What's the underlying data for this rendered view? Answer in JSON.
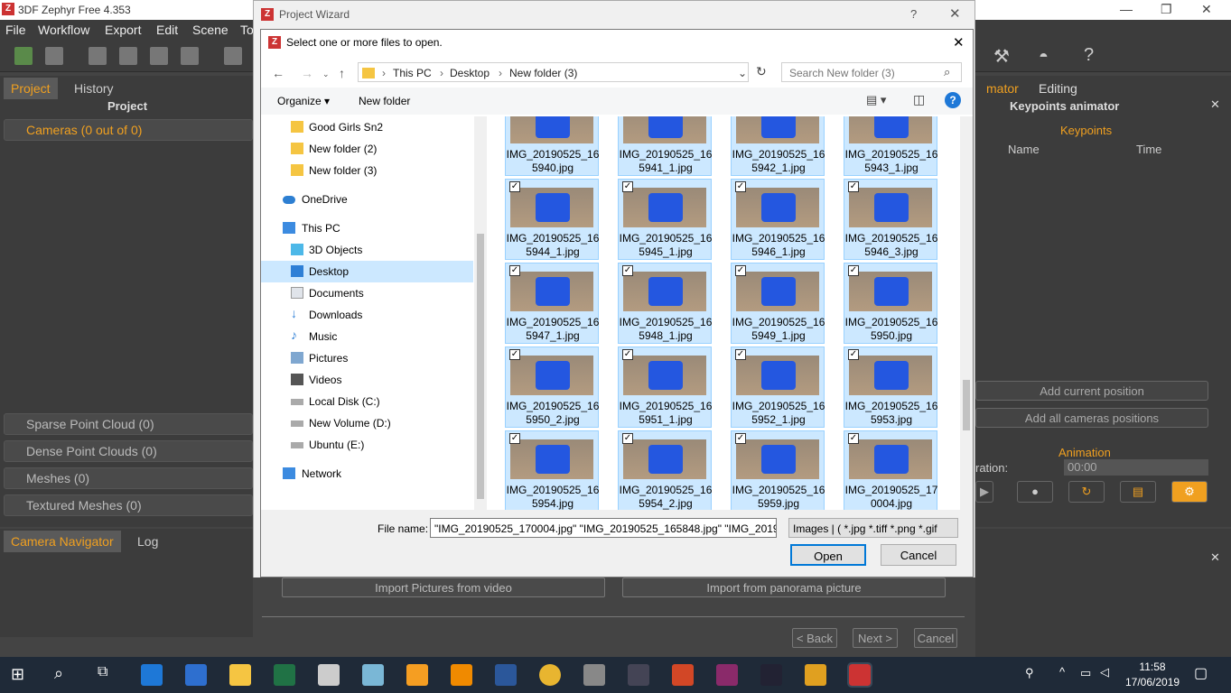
{
  "app": {
    "title": "3DF Zephyr Free 4.353",
    "logo": "Z",
    "menu": [
      "File",
      "Workflow",
      "Export",
      "Edit",
      "Scene",
      "To"
    ],
    "left_tabs": [
      "Project",
      "History"
    ],
    "project_header": "Project",
    "cameras": "Cameras (0 out of 0)",
    "sections": [
      "Sparse Point Cloud (0)",
      "Dense Point Clouds (0)",
      "Meshes (0)",
      "Textured Meshes (0)"
    ],
    "bottom_tabs": [
      "Camera Navigator",
      "Log"
    ],
    "right_tabs": [
      "mator",
      "Editing"
    ],
    "right_header": "Keypoints animator",
    "keypoints": {
      "title": "Keypoints",
      "col_name": "Name",
      "col_time": "Time"
    },
    "add_current": "Add current position",
    "add_all": "Add all cameras positions",
    "animation": {
      "title": "Animation",
      "duration_label": "ration:",
      "duration_value": "00:00"
    }
  },
  "wizard": {
    "title": "Project Wizard",
    "help": "?",
    "import_video": "Import Pictures from video",
    "import_panorama": "Import from panorama picture",
    "back": "< Back",
    "next": "Next >",
    "cancel": "Cancel"
  },
  "dialog": {
    "title": "Select one or more files to open.",
    "breadcrumb": [
      "This PC",
      "Desktop",
      "New folder (3)"
    ],
    "search_placeholder": "Search New folder (3)",
    "organize": "Organize ▾",
    "new_folder": "New folder",
    "nav": [
      {
        "label": "Good Girls Sn2",
        "icon": "folder-icon"
      },
      {
        "label": "New folder (2)",
        "icon": "folder-icon"
      },
      {
        "label": "New folder (3)",
        "icon": "folder-icon"
      },
      {
        "label": "OneDrive",
        "icon": "cloud-icon"
      },
      {
        "label": "This PC",
        "icon": "computer-icon"
      },
      {
        "label": "3D Objects",
        "icon": "cube-icon"
      },
      {
        "label": "Desktop",
        "icon": "desktop-icon"
      },
      {
        "label": "Documents",
        "icon": "document-icon"
      },
      {
        "label": "Downloads",
        "icon": "download-icon"
      },
      {
        "label": "Music",
        "icon": "music-icon"
      },
      {
        "label": "Pictures",
        "icon": "picture-icon"
      },
      {
        "label": "Videos",
        "icon": "video-icon"
      },
      {
        "label": "Local Disk (C:)",
        "icon": "disk-icon"
      },
      {
        "label": "New Volume (D:)",
        "icon": "disk-icon"
      },
      {
        "label": "Ubuntu (E:)",
        "icon": "disk-icon"
      },
      {
        "label": "Network",
        "icon": "network-icon"
      }
    ],
    "files": [
      [
        "IMG_20190525_16",
        "5940.jpg"
      ],
      [
        "IMG_20190525_16",
        "5941_1.jpg"
      ],
      [
        "IMG_20190525_16",
        "5942_1.jpg"
      ],
      [
        "IMG_20190525_16",
        "5943_1.jpg"
      ],
      [
        "IMG_20190525_16",
        "5944_1.jpg"
      ],
      [
        "IMG_20190525_16",
        "5945_1.jpg"
      ],
      [
        "IMG_20190525_16",
        "5946_1.jpg"
      ],
      [
        "IMG_20190525_16",
        "5946_3.jpg"
      ],
      [
        "IMG_20190525_16",
        "5947_1.jpg"
      ],
      [
        "IMG_20190525_16",
        "5948_1.jpg"
      ],
      [
        "IMG_20190525_16",
        "5949_1.jpg"
      ],
      [
        "IMG_20190525_16",
        "5950.jpg"
      ],
      [
        "IMG_20190525_16",
        "5950_2.jpg"
      ],
      [
        "IMG_20190525_16",
        "5951_1.jpg"
      ],
      [
        "IMG_20190525_16",
        "5952_1.jpg"
      ],
      [
        "IMG_20190525_16",
        "5953.jpg"
      ],
      [
        "IMG_20190525_16",
        "5954.jpg"
      ],
      [
        "IMG_20190525_16",
        "5954_2.jpg"
      ],
      [
        "IMG_20190525_16",
        "5959.jpg"
      ],
      [
        "IMG_20190525_17",
        "0004.jpg"
      ]
    ],
    "filename_label": "File name:",
    "filename_value": "\"IMG_20190525_170004.jpg\" \"IMG_20190525_165848.jpg\" \"IMG_20190",
    "filter": "Images | ( *.jpg *.tiff *.png *.gif",
    "open": "Open",
    "cancel": "Cancel"
  },
  "taskbar": {
    "time": "11:58",
    "date": "17/06/2019"
  }
}
